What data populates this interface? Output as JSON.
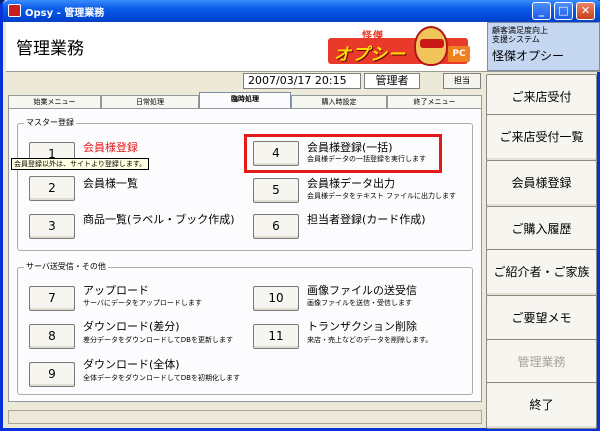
{
  "window": {
    "title": "Opsy - 管理業務"
  },
  "header": {
    "title": "管理業務",
    "logo": {
      "sub": "怪傑",
      "main": "オプシー",
      "badge": "PC"
    },
    "sysinfo": {
      "line1": "顧客満足度向上",
      "line2": "支援システム",
      "name": "怪傑オプシー"
    }
  },
  "infobar": {
    "datetime": "2007/03/17 20:15",
    "role": "管理者",
    "charge_button": "担当"
  },
  "tabs": [
    "始業メニュー",
    "日常処理",
    "臨時処理",
    "購入時設定",
    "終了メニュー"
  ],
  "active_tab": 2,
  "master_group": {
    "label": "マスター登録",
    "items": [
      {
        "num": "1",
        "title": "会員様登録",
        "desc": ""
      },
      {
        "num": "2",
        "title": "会員様一覧",
        "desc": ""
      },
      {
        "num": "3",
        "title": "商品一覧(ラベル・ブック作成)",
        "desc": ""
      },
      {
        "num": "4",
        "title": "会員様登録(一括)",
        "desc": "会員様データの一括登録を実行します"
      },
      {
        "num": "5",
        "title": "会員様データ出力",
        "desc": "会員様データをテキスト ファイルに出力します"
      },
      {
        "num": "6",
        "title": "担当者登録(カード作成)",
        "desc": ""
      }
    ],
    "tooltip": "会員登録以外は、サイトより登録します。"
  },
  "server_group": {
    "label": "サーバ送受信・その他",
    "items": [
      {
        "num": "7",
        "title": "アップロード",
        "desc": "サーバにデータをアップロードします"
      },
      {
        "num": "8",
        "title": "ダウンロード(差分)",
        "desc": "差分データをダウンロードしてDBを更新します"
      },
      {
        "num": "9",
        "title": "ダウンロード(全体)",
        "desc": "全体データをダウンロードしてDBを初期化します"
      },
      {
        "num": "10",
        "title": "画像ファイルの送受信",
        "desc": "画像ファイルを送信・受信します"
      },
      {
        "num": "11",
        "title": "トランザクション削除",
        "desc": "来店・売上などのデータを削除します。"
      }
    ]
  },
  "sidebar": [
    {
      "label": "ご来店受付",
      "enabled": true
    },
    {
      "label": "ご来店受付一覧",
      "enabled": true
    },
    {
      "label": "会員様登録",
      "enabled": true
    },
    {
      "label": "ご購入履歴",
      "enabled": true
    },
    {
      "label": "ご紹介者・ご家族",
      "enabled": true
    },
    {
      "label": "ご要望メモ",
      "enabled": true
    },
    {
      "label": "管理業務",
      "enabled": false
    },
    {
      "label": "終了",
      "enabled": true
    }
  ],
  "colors": {
    "highlight": "#e4191a",
    "active_item": "#e4191a",
    "titlebar": "#0a5be6"
  },
  "icons": {
    "app": "app-icon",
    "minimize": "minimize-icon",
    "maximize": "maximize-icon",
    "close": "close-icon"
  }
}
